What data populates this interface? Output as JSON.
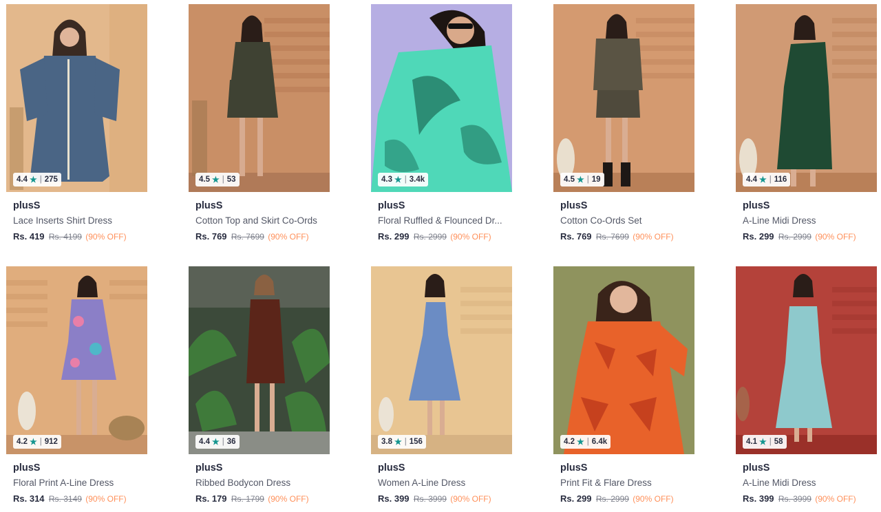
{
  "products": [
    {
      "brand": "plusS",
      "title": "Lace Inserts Shirt Dress",
      "price": "Rs. 419",
      "mrp": "Rs. 4199",
      "discount": "(90% OFF)",
      "rating": "4.4",
      "count": "275",
      "bg": "#e3b88c",
      "dress": "#4a6585"
    },
    {
      "brand": "plusS",
      "title": "Cotton Top and Skirt Co-Ords",
      "price": "Rs. 769",
      "mrp": "Rs. 7699",
      "discount": "(90% OFF)",
      "rating": "4.5",
      "count": "53",
      "bg": "#c98f66",
      "dress": "#3f4233"
    },
    {
      "brand": "plusS",
      "title": "Floral Ruffled & Flounced Dr...",
      "price": "Rs. 299",
      "mrp": "Rs. 2999",
      "discount": "(90% OFF)",
      "rating": "4.3",
      "count": "3.4k",
      "bg": "#b6aee3",
      "dress": "#4fd8b8"
    },
    {
      "brand": "plusS",
      "title": "Cotton Co-Ords Set",
      "price": "Rs. 769",
      "mrp": "Rs. 7699",
      "discount": "(90% OFF)",
      "rating": "4.5",
      "count": "19",
      "bg": "#d49a70",
      "dress": "#5a5444"
    },
    {
      "brand": "plusS",
      "title": "A-Line Midi Dress",
      "price": "Rs. 299",
      "mrp": "Rs. 2999",
      "discount": "(90% OFF)",
      "rating": "4.4",
      "count": "116",
      "bg": "#d09a74",
      "dress": "#1f4a33"
    },
    {
      "brand": "plusS",
      "title": "Floral Print A-Line Dress",
      "price": "Rs. 314",
      "mrp": "Rs. 3149",
      "discount": "(90% OFF)",
      "rating": "4.2",
      "count": "912",
      "bg": "#e0ad7d",
      "dress": "#8b7fc7"
    },
    {
      "brand": "plusS",
      "title": "Ribbed Bodycon Dress",
      "price": "Rs. 179",
      "mrp": "Rs. 1799",
      "discount": "(90% OFF)",
      "rating": "4.4",
      "count": "36",
      "bg": "#3c4a3a",
      "dress": "#5b2519"
    },
    {
      "brand": "plusS",
      "title": "Women A-Line Dress",
      "price": "Rs. 399",
      "mrp": "Rs. 3999",
      "discount": "(90% OFF)",
      "rating": "3.8",
      "count": "156",
      "bg": "#e8c592",
      "dress": "#6b8cc4"
    },
    {
      "brand": "plusS",
      "title": "Print Fit & Flare Dress",
      "price": "Rs. 299",
      "mrp": "Rs. 2999",
      "discount": "(90% OFF)",
      "rating": "4.2",
      "count": "6.4k",
      "bg": "#8f935e",
      "dress": "#e8622a"
    },
    {
      "brand": "plusS",
      "title": "A-Line Midi Dress",
      "price": "Rs. 399",
      "mrp": "Rs. 3999",
      "discount": "(90% OFF)",
      "rating": "4.1",
      "count": "58",
      "bg": "#b4423a",
      "dress": "#8ec9cc"
    }
  ],
  "colors": {
    "star": "#14958f",
    "discount": "#ff905a",
    "brand": "#282c3f"
  }
}
